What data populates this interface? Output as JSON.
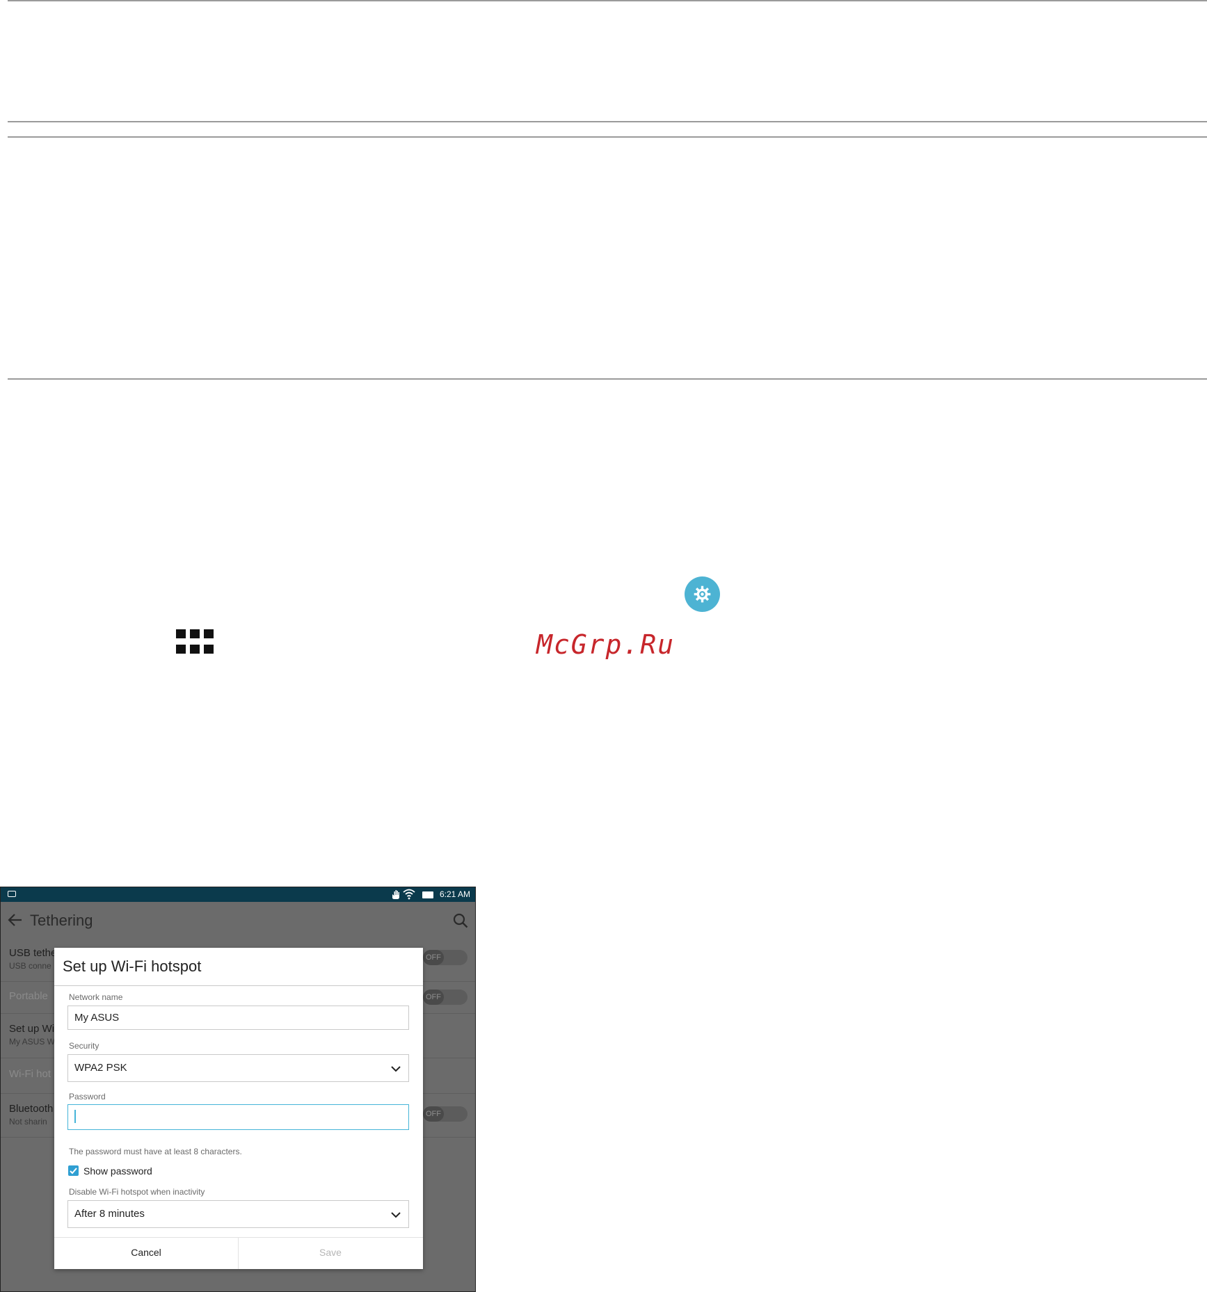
{
  "watermark": "McGrp.Ru",
  "icons": [
    "settings-icon",
    "apps-grid-icon"
  ],
  "accent_color": "#4db3d3",
  "phone": {
    "status_time": "6:21 AM",
    "toolbar_title": "Tethering",
    "background_rows": [
      {
        "title": "USB tethe",
        "subtitle": "USB conne",
        "toggle": "OFF"
      },
      {
        "title": "Portable",
        "subtitle": "",
        "toggle": "OFF"
      },
      {
        "title": "Set up Wi",
        "subtitle": "My ASUS W"
      },
      {
        "title": "Wi-Fi hot",
        "subtitle": ""
      },
      {
        "title": "Bluetooth",
        "subtitle": "Not sharin",
        "toggle": "OFF"
      }
    ],
    "dialog": {
      "title": "Set up Wi-Fi hotspot",
      "network_name_label": "Network name",
      "network_name_value": "My ASUS",
      "security_label": "Security",
      "security_value": "WPA2 PSK",
      "password_label": "Password",
      "password_value": "",
      "password_hint": "The password must have at least 8 characters.",
      "show_password_label": "Show password",
      "show_password_checked": true,
      "inactivity_label": "Disable Wi-Fi hotspot when inactivity",
      "inactivity_value": "After 8 minutes",
      "cancel_label": "Cancel",
      "save_label": "Save"
    }
  }
}
